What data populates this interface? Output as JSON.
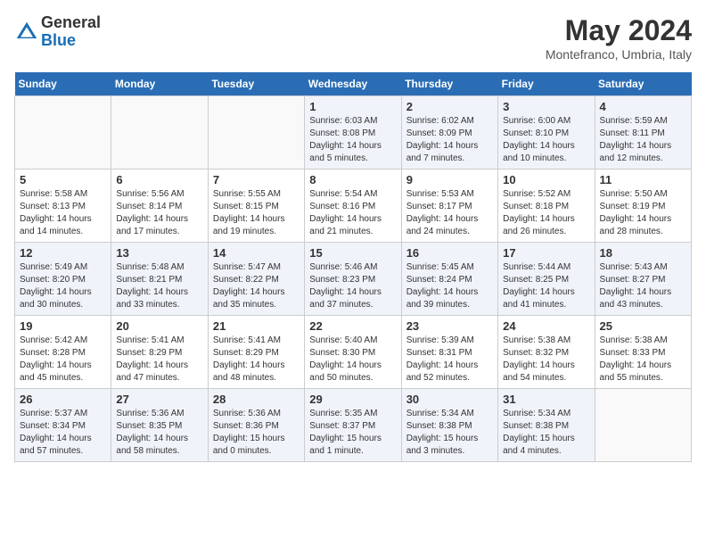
{
  "logo": {
    "general": "General",
    "blue": "Blue"
  },
  "title": "May 2024",
  "subtitle": "Montefranco, Umbria, Italy",
  "weekdays": [
    "Sunday",
    "Monday",
    "Tuesday",
    "Wednesday",
    "Thursday",
    "Friday",
    "Saturday"
  ],
  "weeks": [
    [
      {
        "day": "",
        "sunrise": "",
        "sunset": "",
        "daylight": ""
      },
      {
        "day": "",
        "sunrise": "",
        "sunset": "",
        "daylight": ""
      },
      {
        "day": "",
        "sunrise": "",
        "sunset": "",
        "daylight": ""
      },
      {
        "day": "1",
        "sunrise": "Sunrise: 6:03 AM",
        "sunset": "Sunset: 8:08 PM",
        "daylight": "Daylight: 14 hours and 5 minutes."
      },
      {
        "day": "2",
        "sunrise": "Sunrise: 6:02 AM",
        "sunset": "Sunset: 8:09 PM",
        "daylight": "Daylight: 14 hours and 7 minutes."
      },
      {
        "day": "3",
        "sunrise": "Sunrise: 6:00 AM",
        "sunset": "Sunset: 8:10 PM",
        "daylight": "Daylight: 14 hours and 10 minutes."
      },
      {
        "day": "4",
        "sunrise": "Sunrise: 5:59 AM",
        "sunset": "Sunset: 8:11 PM",
        "daylight": "Daylight: 14 hours and 12 minutes."
      }
    ],
    [
      {
        "day": "5",
        "sunrise": "Sunrise: 5:58 AM",
        "sunset": "Sunset: 8:13 PM",
        "daylight": "Daylight: 14 hours and 14 minutes."
      },
      {
        "day": "6",
        "sunrise": "Sunrise: 5:56 AM",
        "sunset": "Sunset: 8:14 PM",
        "daylight": "Daylight: 14 hours and 17 minutes."
      },
      {
        "day": "7",
        "sunrise": "Sunrise: 5:55 AM",
        "sunset": "Sunset: 8:15 PM",
        "daylight": "Daylight: 14 hours and 19 minutes."
      },
      {
        "day": "8",
        "sunrise": "Sunrise: 5:54 AM",
        "sunset": "Sunset: 8:16 PM",
        "daylight": "Daylight: 14 hours and 21 minutes."
      },
      {
        "day": "9",
        "sunrise": "Sunrise: 5:53 AM",
        "sunset": "Sunset: 8:17 PM",
        "daylight": "Daylight: 14 hours and 24 minutes."
      },
      {
        "day": "10",
        "sunrise": "Sunrise: 5:52 AM",
        "sunset": "Sunset: 8:18 PM",
        "daylight": "Daylight: 14 hours and 26 minutes."
      },
      {
        "day": "11",
        "sunrise": "Sunrise: 5:50 AM",
        "sunset": "Sunset: 8:19 PM",
        "daylight": "Daylight: 14 hours and 28 minutes."
      }
    ],
    [
      {
        "day": "12",
        "sunrise": "Sunrise: 5:49 AM",
        "sunset": "Sunset: 8:20 PM",
        "daylight": "Daylight: 14 hours and 30 minutes."
      },
      {
        "day": "13",
        "sunrise": "Sunrise: 5:48 AM",
        "sunset": "Sunset: 8:21 PM",
        "daylight": "Daylight: 14 hours and 33 minutes."
      },
      {
        "day": "14",
        "sunrise": "Sunrise: 5:47 AM",
        "sunset": "Sunset: 8:22 PM",
        "daylight": "Daylight: 14 hours and 35 minutes."
      },
      {
        "day": "15",
        "sunrise": "Sunrise: 5:46 AM",
        "sunset": "Sunset: 8:23 PM",
        "daylight": "Daylight: 14 hours and 37 minutes."
      },
      {
        "day": "16",
        "sunrise": "Sunrise: 5:45 AM",
        "sunset": "Sunset: 8:24 PM",
        "daylight": "Daylight: 14 hours and 39 minutes."
      },
      {
        "day": "17",
        "sunrise": "Sunrise: 5:44 AM",
        "sunset": "Sunset: 8:25 PM",
        "daylight": "Daylight: 14 hours and 41 minutes."
      },
      {
        "day": "18",
        "sunrise": "Sunrise: 5:43 AM",
        "sunset": "Sunset: 8:27 PM",
        "daylight": "Daylight: 14 hours and 43 minutes."
      }
    ],
    [
      {
        "day": "19",
        "sunrise": "Sunrise: 5:42 AM",
        "sunset": "Sunset: 8:28 PM",
        "daylight": "Daylight: 14 hours and 45 minutes."
      },
      {
        "day": "20",
        "sunrise": "Sunrise: 5:41 AM",
        "sunset": "Sunset: 8:29 PM",
        "daylight": "Daylight: 14 hours and 47 minutes."
      },
      {
        "day": "21",
        "sunrise": "Sunrise: 5:41 AM",
        "sunset": "Sunset: 8:29 PM",
        "daylight": "Daylight: 14 hours and 48 minutes."
      },
      {
        "day": "22",
        "sunrise": "Sunrise: 5:40 AM",
        "sunset": "Sunset: 8:30 PM",
        "daylight": "Daylight: 14 hours and 50 minutes."
      },
      {
        "day": "23",
        "sunrise": "Sunrise: 5:39 AM",
        "sunset": "Sunset: 8:31 PM",
        "daylight": "Daylight: 14 hours and 52 minutes."
      },
      {
        "day": "24",
        "sunrise": "Sunrise: 5:38 AM",
        "sunset": "Sunset: 8:32 PM",
        "daylight": "Daylight: 14 hours and 54 minutes."
      },
      {
        "day": "25",
        "sunrise": "Sunrise: 5:38 AM",
        "sunset": "Sunset: 8:33 PM",
        "daylight": "Daylight: 14 hours and 55 minutes."
      }
    ],
    [
      {
        "day": "26",
        "sunrise": "Sunrise: 5:37 AM",
        "sunset": "Sunset: 8:34 PM",
        "daylight": "Daylight: 14 hours and 57 minutes."
      },
      {
        "day": "27",
        "sunrise": "Sunrise: 5:36 AM",
        "sunset": "Sunset: 8:35 PM",
        "daylight": "Daylight: 14 hours and 58 minutes."
      },
      {
        "day": "28",
        "sunrise": "Sunrise: 5:36 AM",
        "sunset": "Sunset: 8:36 PM",
        "daylight": "Daylight: 15 hours and 0 minutes."
      },
      {
        "day": "29",
        "sunrise": "Sunrise: 5:35 AM",
        "sunset": "Sunset: 8:37 PM",
        "daylight": "Daylight: 15 hours and 1 minute."
      },
      {
        "day": "30",
        "sunrise": "Sunrise: 5:34 AM",
        "sunset": "Sunset: 8:38 PM",
        "daylight": "Daylight: 15 hours and 3 minutes."
      },
      {
        "day": "31",
        "sunrise": "Sunrise: 5:34 AM",
        "sunset": "Sunset: 8:38 PM",
        "daylight": "Daylight: 15 hours and 4 minutes."
      },
      {
        "day": "",
        "sunrise": "",
        "sunset": "",
        "daylight": ""
      }
    ]
  ]
}
